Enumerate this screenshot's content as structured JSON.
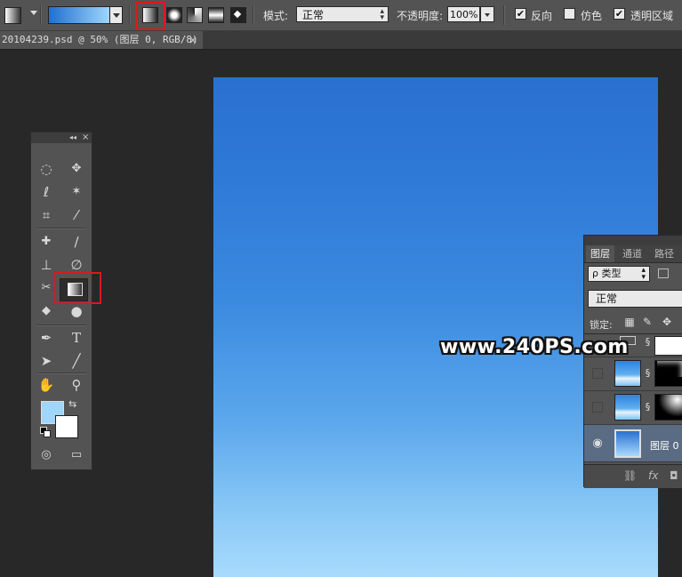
{
  "options_bar": {
    "tool_preset_icon": "gradient-tool-preset-icon",
    "gradient_colors": [
      "#1f6fd1",
      "#9fd6fb"
    ],
    "gradient_types": [
      "linear",
      "radial",
      "angle",
      "reflected",
      "diamond"
    ],
    "selected_gradient_type": "linear",
    "mode_label": "模式:",
    "mode_value": "正常",
    "opacity_label": "不透明度:",
    "opacity_value": "100%",
    "reverse_label": "反向",
    "reverse_checked": true,
    "dither_label": "仿色",
    "dither_checked": false,
    "transparency_label": "透明区域",
    "transparency_checked": true
  },
  "document": {
    "tab_title": "20104239.psd @ 50% (图层 0, RGB/8) *",
    "close": "×",
    "canvas_gradient": [
      "#2a70d1",
      "#a8dafc"
    ]
  },
  "watermark": "www.240PS.com",
  "toolbox": {
    "collapse": "◂◂",
    "close": "×",
    "foreground_color": "#9fd6fb",
    "background_color": "#ffffff",
    "selected_tool": "gradient-tool",
    "tools": {
      "marquee": "◌",
      "move": "✥",
      "lasso": "ℓ",
      "magic_wand": "✶",
      "crop": "⌗",
      "eyedropper": "⁄",
      "healing": "✚",
      "brush": "∕",
      "stamp": "⊥",
      "history_brush": "∅",
      "eraser": "✂",
      "blur": "◆",
      "dodge": "●",
      "pen": "✒",
      "type": "T",
      "path_select": "➤",
      "line": "╱",
      "hand": "✋",
      "zoom": "⚲",
      "swap": "⇆",
      "quick_mask": "◎",
      "screen_mode": "▭"
    }
  },
  "layers_panel": {
    "tabs": [
      "图层",
      "通道",
      "路径"
    ],
    "filter_label": "ρ 类型",
    "blend_mode": "正常",
    "lock_label": "锁定:",
    "lock_icons": [
      "▦",
      "✎",
      "✥"
    ],
    "layers": [
      {
        "name": "",
        "visible": false,
        "thumb": "sky",
        "has_mask": true,
        "mask": "dark-white-top"
      },
      {
        "name": "",
        "visible": false,
        "thumb": "sky",
        "has_mask": true,
        "mask": "dark-white-top"
      },
      {
        "name": "",
        "visible": false,
        "thumb": "sky",
        "has_mask": true,
        "mask": "dark-white-corner"
      },
      {
        "name": "图层 0",
        "visible": true,
        "thumb": "blue-gradient",
        "has_mask": false,
        "selected": true
      }
    ],
    "bottom_icons": [
      "⛓",
      "fx",
      "◘"
    ]
  }
}
